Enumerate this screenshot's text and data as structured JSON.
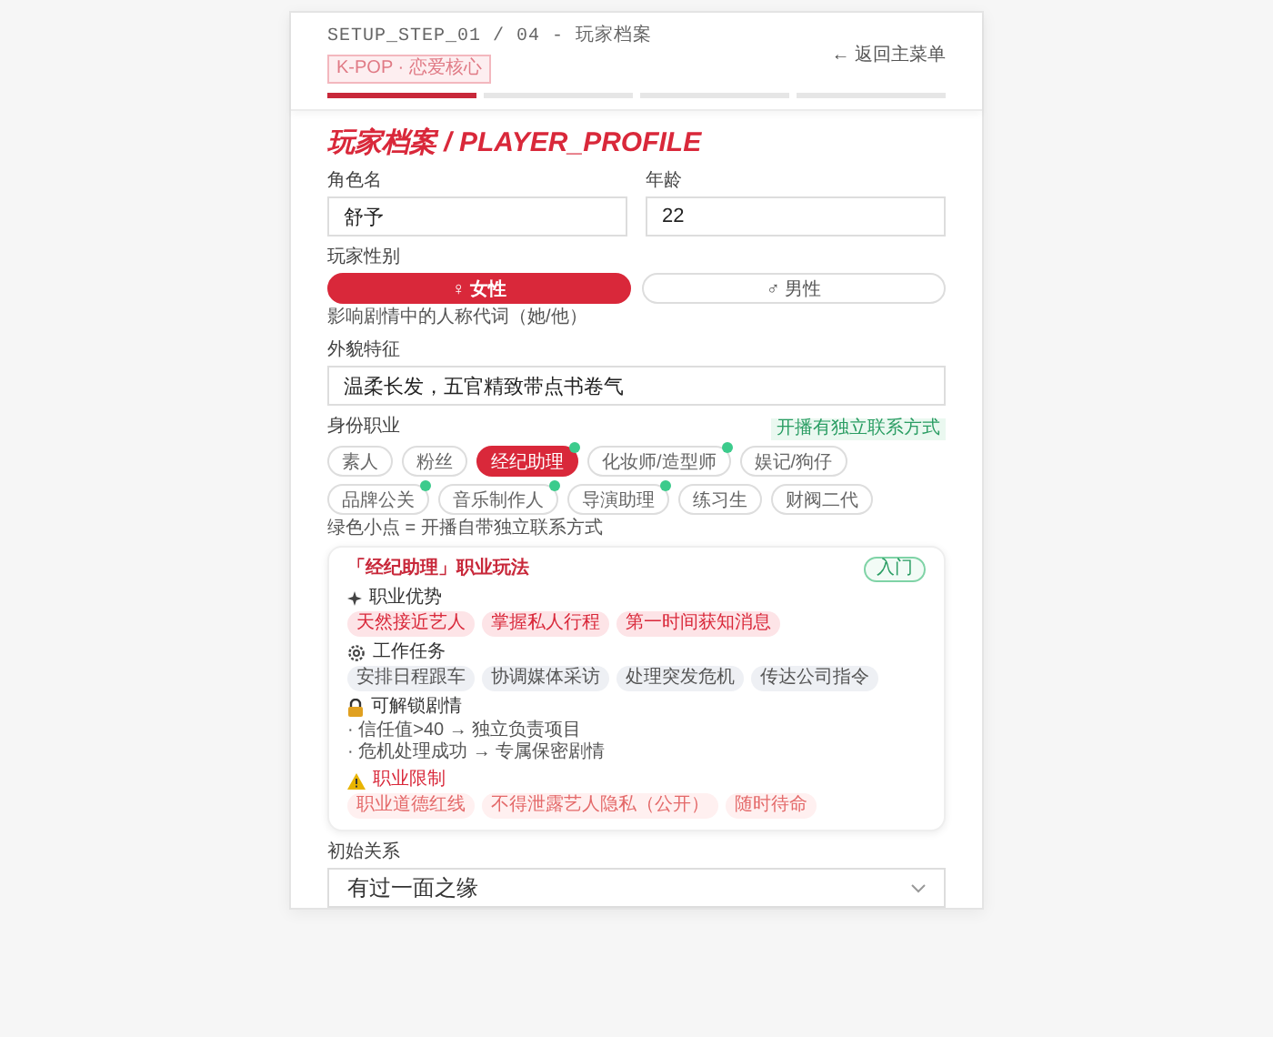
{
  "header": {
    "step": "SETUP_STEP_01 / 04 - 玩家档案",
    "tag": "K-POP · 恋爱核心",
    "back": "← 返回主菜单",
    "steps": [
      {
        "done": true
      },
      {
        "done": false
      },
      {
        "done": false
      },
      {
        "done": false
      }
    ]
  },
  "title": "玩家档案 / PLAYER_PROFILE",
  "fields": [
    {
      "label": "角色名",
      "value": "舒予"
    },
    {
      "label": "年龄",
      "value": "22"
    }
  ],
  "gender": {
    "label": "玩家性别",
    "options": [
      {
        "symbol": "♀",
        "label": "女性",
        "selected": true
      },
      {
        "symbol": "♂",
        "label": "男性",
        "selected": false
      }
    ],
    "hint": "影响剧情中的人称代词（她/他）"
  },
  "appearance": {
    "label": "外貌特征",
    "value": "温柔长发，五官精致带点书卷气"
  },
  "profession": {
    "label": "身份职业",
    "badge": "开播有独立联系方式",
    "options": [
      {
        "label": "素人",
        "selected": false,
        "contact": false
      },
      {
        "label": "粉丝",
        "selected": false,
        "contact": false
      },
      {
        "label": "经纪助理",
        "selected": true,
        "contact": true
      },
      {
        "label": "化妆师/造型师",
        "selected": false,
        "contact": true
      },
      {
        "label": "娱记/狗仔",
        "selected": false,
        "contact": false
      },
      {
        "label": "品牌公关",
        "selected": false,
        "contact": true
      },
      {
        "label": "音乐制作人",
        "selected": false,
        "contact": true
      },
      {
        "label": "导演助理",
        "selected": false,
        "contact": true
      },
      {
        "label": "练习生",
        "selected": false,
        "contact": false
      },
      {
        "label": "财阀二代",
        "selected": false,
        "contact": false
      }
    ],
    "legend": "绿色小点 = 开播自带独立联系方式"
  },
  "career": {
    "title": "「经纪助理」职业玩法",
    "difficulty": "入门",
    "sections": [
      {
        "kind": "advantages",
        "title": "职业优势",
        "items": [
          "天然接近艺人",
          "掌握私人行程",
          "第一时间获知消息"
        ]
      },
      {
        "kind": "tasks",
        "title": "工作任务",
        "items": [
          "安排日程跟车",
          "协调媒体采访",
          "处理突发危机",
          "传达公司指令"
        ]
      },
      {
        "kind": "unlocks",
        "title": "可解锁剧情",
        "items": [
          "· 信任值>40 → 独立负责项目",
          "· 危机处理成功 → 专属保密剧情"
        ]
      },
      {
        "kind": "limits",
        "title": "职业限制",
        "items": [
          "职业道德红线",
          "不得泄露艺人隐私（公开）",
          "随时待命"
        ]
      }
    ]
  },
  "relation": {
    "label": "初始关系",
    "value": "有过一面之缘"
  }
}
